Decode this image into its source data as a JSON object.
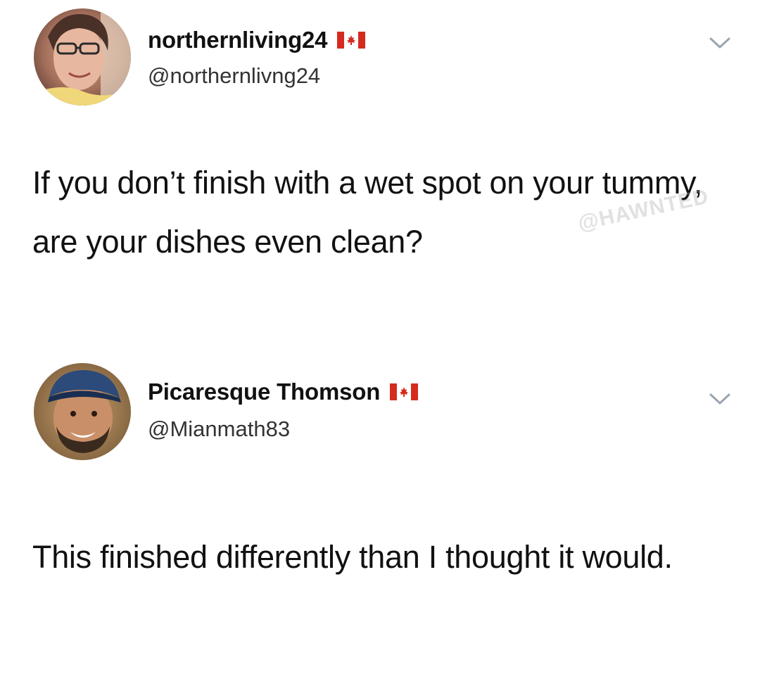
{
  "tweets": [
    {
      "display_name": "northernliving24",
      "handle": "@northernlivng24",
      "text": "If you don’t finish with a wet spot on your tummy, are your dishes even clean?",
      "avatar_icon": "user-avatar-woman-glasses",
      "flag_icon": "canada-flag-icon",
      "menu_icon": "chevron-down-icon"
    },
    {
      "display_name": "Picaresque Thomson",
      "handle": "@Mianmath83",
      "text": "This finished differently than I thought it would.",
      "avatar_icon": "user-avatar-man-cap",
      "flag_icon": "canada-flag-icon",
      "menu_icon": "chevron-down-icon"
    }
  ],
  "watermark": "@HAWNTED",
  "colors": {
    "background": "#ffffff",
    "text": "#111111",
    "handle": "#333333",
    "flag_red": "#d52b1e",
    "chevron": "#9aa5b1"
  }
}
